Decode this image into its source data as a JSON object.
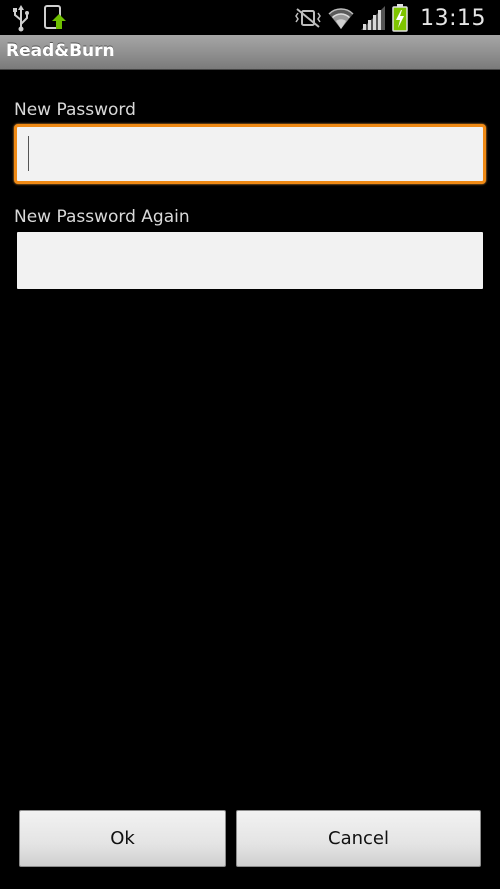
{
  "status_bar": {
    "time": "13:15",
    "icons": [
      "usb-icon",
      "upload-notification-icon",
      "vibrate-mute-icon",
      "wifi-icon",
      "signal-icon",
      "battery-charging-icon"
    ]
  },
  "app": {
    "title": "Read&Burn"
  },
  "form": {
    "new_password_label": "New Password",
    "new_password_value": "",
    "new_password_again_label": "New Password Again",
    "new_password_again_value": ""
  },
  "buttons": {
    "ok_label": "Ok",
    "cancel_label": "Cancel"
  },
  "colors": {
    "focus_border": "#f08a15",
    "battery_charge": "#7fc400",
    "upload_arrow": "#6fbf00"
  }
}
